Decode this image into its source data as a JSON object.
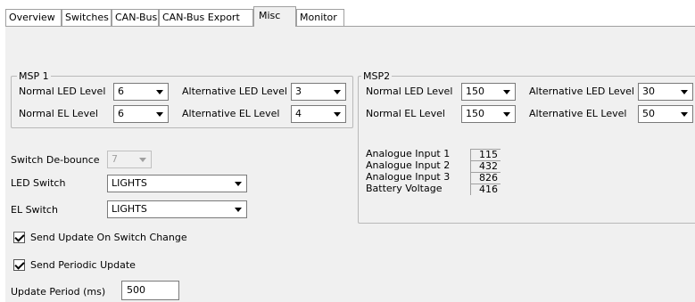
{
  "tabs": [
    {
      "label": "Overview",
      "active": false
    },
    {
      "label": "Switches",
      "active": false
    },
    {
      "label": "CAN-Bus",
      "active": false
    },
    {
      "label": "CAN-Bus Export",
      "active": false
    },
    {
      "label": "Misc",
      "active": true
    },
    {
      "label": "Monitor",
      "active": false
    }
  ],
  "msp1": {
    "title": "MSP 1",
    "normal_led_label": "Normal LED Level",
    "normal_led_value": "6",
    "alt_led_label": "Alternative LED Level",
    "alt_led_value": "3",
    "normal_el_label": "Normal EL Level",
    "normal_el_value": "6",
    "alt_el_label": "Alternative EL Level",
    "alt_el_value": "4"
  },
  "msp2": {
    "title": "MSP2",
    "normal_led_label": "Normal LED Level",
    "normal_led_value": "150",
    "alt_led_label": "Alternative LED Level",
    "alt_led_value": "30",
    "normal_el_label": "Normal EL Level",
    "normal_el_value": "150",
    "alt_el_label": "Alternative EL Level",
    "alt_el_value": "50",
    "analogue": [
      {
        "label": "Analogue Input 1",
        "value": "115"
      },
      {
        "label": "Analogue Input 2",
        "value": "432"
      },
      {
        "label": "Analogue Input 3",
        "value": "826"
      },
      {
        "label": "Battery Voltage",
        "value": "416"
      }
    ]
  },
  "settings": {
    "debounce_label": "Switch De-bounce",
    "debounce_value": "7",
    "led_switch_label": "LED Switch",
    "led_switch_value": "LIGHTS",
    "el_switch_label": "EL Switch",
    "el_switch_value": "LIGHTS",
    "send_on_change_label": "Send Update On Switch Change",
    "send_on_change_checked": true,
    "send_periodic_label": "Send Periodic Update",
    "send_periodic_checked": true,
    "update_period_label": "Update Period (ms)",
    "update_period_value": "500"
  }
}
